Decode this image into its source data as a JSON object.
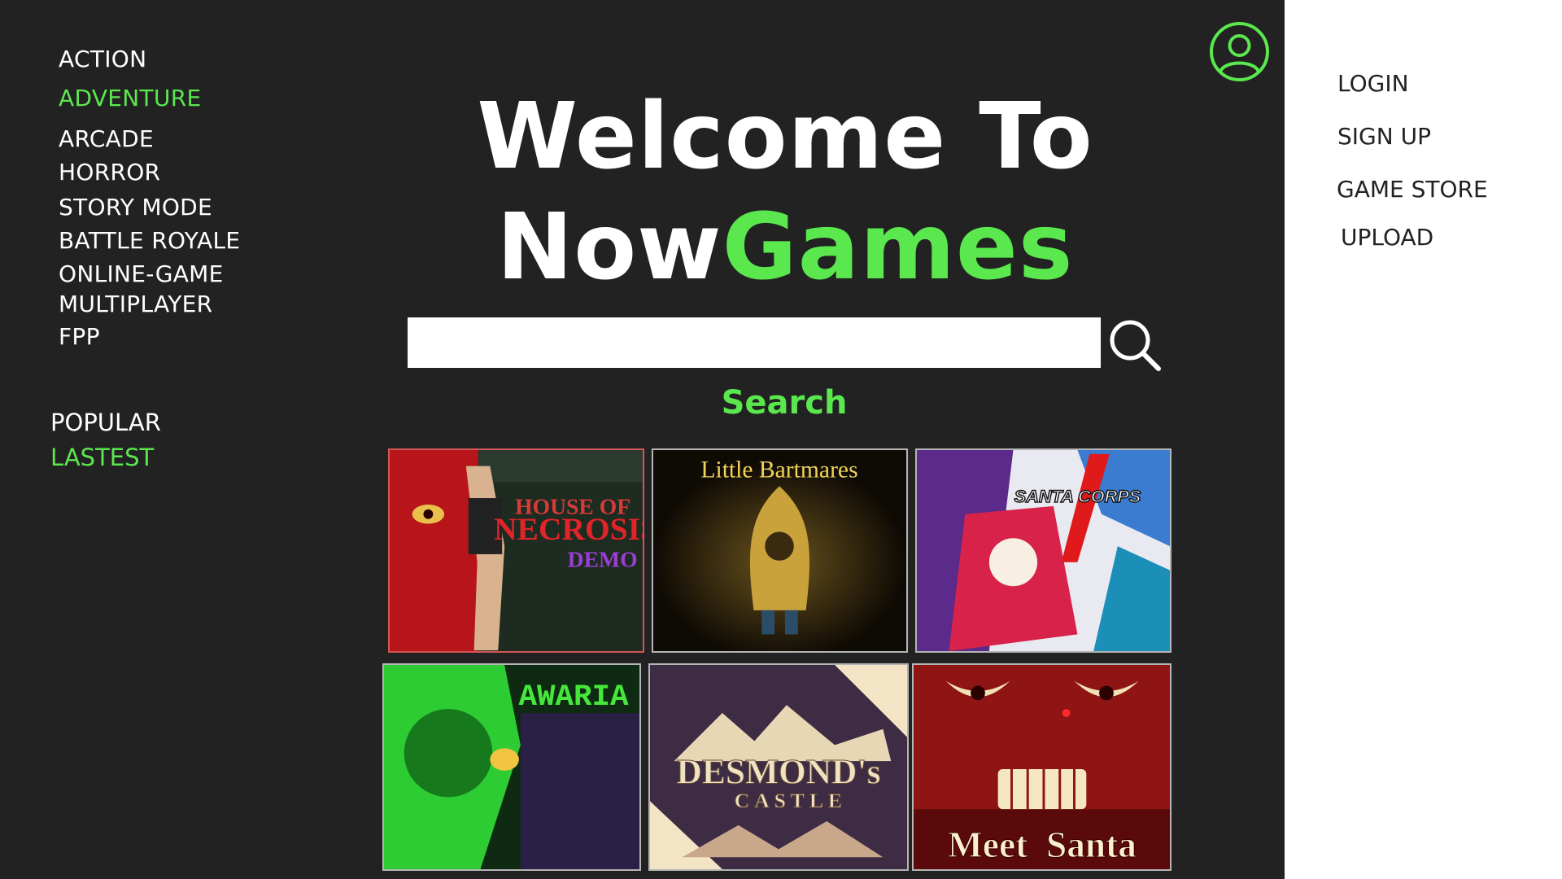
{
  "genres": [
    {
      "label": "ACTION"
    },
    {
      "label": "ADVENTURE"
    },
    {
      "label": "ARCADE"
    },
    {
      "label": "HORROR"
    },
    {
      "label": "STORY MODE"
    },
    {
      "label": "BATTLE ROYALE"
    },
    {
      "label": "ONLINE-GAME"
    },
    {
      "label": "MULTIPLAYER"
    },
    {
      "label": "FPP"
    }
  ],
  "sort": {
    "popular": "POPULAR",
    "latest": "LASTEST"
  },
  "hero": {
    "line1": "Welcome To",
    "line2_prefix": "Now",
    "line2_accent": "Games"
  },
  "search": {
    "value": "",
    "placeholder": "",
    "label": "Search"
  },
  "nav": {
    "login": "LOGIN",
    "signup": "SIGN UP",
    "store": "GAME STORE",
    "upload": "UPLOAD"
  },
  "games": {
    "g1": {
      "line1": "HOUSE OF",
      "line2": "NECROSIS",
      "line3": "DEMO"
    },
    "g2": {
      "title": "Little Bartmares"
    },
    "g3": {
      "title": "SANTA CORPS"
    },
    "g4": {
      "title": "AWARIA"
    },
    "g5": {
      "line1": "DESMOND's",
      "line2": "CASTLE"
    },
    "g6": {
      "title": "Meet  Santa"
    }
  },
  "colors": {
    "accent": "#5ae84e",
    "background": "#222222",
    "panel": "#ffffff"
  },
  "icons": {
    "avatar": "user-circle-icon",
    "search": "magnifier-icon"
  }
}
